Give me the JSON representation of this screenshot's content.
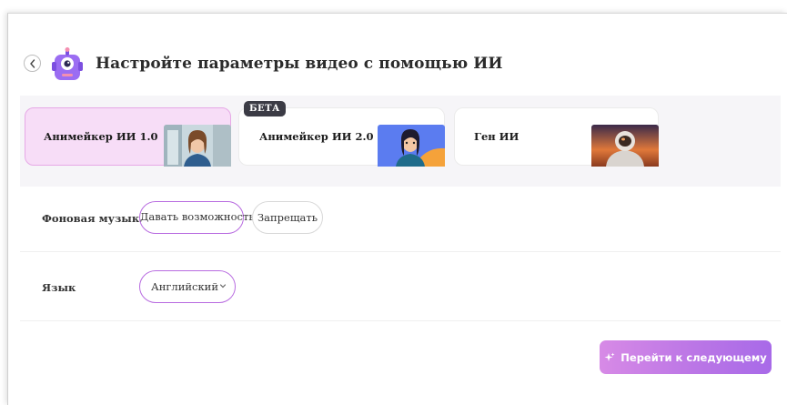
{
  "header": {
    "title": "Настройте параметры видео с помощью ИИ",
    "back_icon": "chevron-left-icon",
    "logo_icon": "robot-mascot-icon"
  },
  "models": [
    {
      "label": "Анимейкер ИИ 1.0",
      "selected": true,
      "thumb": "woman-in-office-thumbnail"
    },
    {
      "label": "Анимейкер ИИ 2.0",
      "selected": false,
      "badge": "БЕТА",
      "thumb": "cartoon-woman-thumbnail"
    },
    {
      "label": "Ген ИИ",
      "selected": false,
      "thumb": "astronaut-thumbnail"
    }
  ],
  "music": {
    "label": "Фоновая музыка",
    "options": [
      "Давать возможность",
      "Запрещать"
    ],
    "selected": "Давать возможность"
  },
  "language": {
    "label": "Язык",
    "value": "Английский",
    "icon": "chevron-down-icon"
  },
  "next_button": {
    "label": "Перейти к следующему",
    "icon": "sparkle-icon"
  },
  "colors": {
    "accent": "#b86be0",
    "selected_card_bg": "#f7ddf7",
    "button_gradient_start": "#d78ae6",
    "button_gradient_end": "#a86ae8",
    "badge_bg": "#3b3b45"
  }
}
